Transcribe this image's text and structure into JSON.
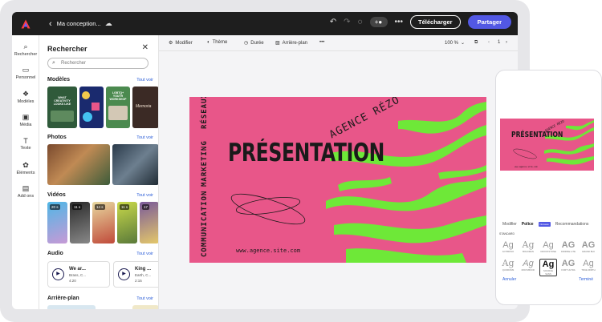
{
  "app": {
    "doc_title": "Ma conception...",
    "download_label": "Télécharger",
    "share_label": "Partager"
  },
  "rail": [
    {
      "label": "Rechercher",
      "icon": "search-icon"
    },
    {
      "label": "Personnel",
      "icon": "folder-icon"
    },
    {
      "label": "Modèles",
      "icon": "templates-icon"
    },
    {
      "label": "Média",
      "icon": "media-icon"
    },
    {
      "label": "Texte",
      "icon": "text-icon"
    },
    {
      "label": "Éléments",
      "icon": "elements-icon"
    },
    {
      "label": "Add ons",
      "icon": "addons-icon"
    }
  ],
  "panel": {
    "title": "Rechercher",
    "search_placeholder": "Rechercher",
    "see_all": "Tout voir",
    "sections": {
      "templates": "Modèles",
      "photos": "Photos",
      "videos": "Vidéos",
      "audio": "Audio",
      "backgrounds": "Arrière-plan"
    },
    "video_durations": [
      "20 s",
      "11 s",
      "14 s",
      "11 s",
      "17"
    ],
    "audio": [
      {
        "title": "We ar...",
        "artist": "Brass, C...",
        "duration": "4:20"
      },
      {
        "title": "King ...",
        "artist": "Earth, C...",
        "duration": "2:15"
      }
    ],
    "template_texts": {
      "t1": "WHAT CREATIVITY LOOKS LIKE",
      "t2": "LGBTQ+ YOUTH WORKSHOP",
      "t3": "Memoria"
    }
  },
  "editbar": {
    "modify": "Modifier",
    "theme": "Thème",
    "duration": "Durée",
    "background": "Arrière-plan",
    "more": "•••",
    "zoom": "100 %",
    "page": "1"
  },
  "slide": {
    "title": "PRÉSENTATION",
    "side_words": [
      "RÉSEAUX",
      "MARKETING",
      "COMMUNICATION"
    ],
    "agency": "AGENCE RÉZO",
    "url": "www.agence.site.com"
  },
  "phone": {
    "tabs": [
      "Modifier",
      "Police",
      "Recommandations"
    ],
    "tab_badge": "Nouveau",
    "standard_label": "STANDARD",
    "fonts_row1": [
      "Ag",
      "Ag",
      "Ag",
      "AG",
      "AG"
    ],
    "fonts_row1_names": [
      "ACTIBOSO",
      "BOLDMAN",
      "CROOKSTONE",
      "DIDRIKE LITE",
      "GRAND BLK"
    ],
    "fonts_row2": [
      "Ag",
      "Ag",
      "Ag",
      "AG",
      "Ag"
    ],
    "fonts_row2_names": [
      "QUORUMS",
      "MOOVBOOK",
      "SOURCE SANS",
      "FORT ULTRA",
      "TRUE MIRTH"
    ],
    "cancel": "Annuler",
    "done": "Terminé"
  },
  "colors": {
    "accent": "#5258e4",
    "slide_pink": "#e85689",
    "slide_green": "#6ee838",
    "topbar": "#1e1e1e"
  }
}
